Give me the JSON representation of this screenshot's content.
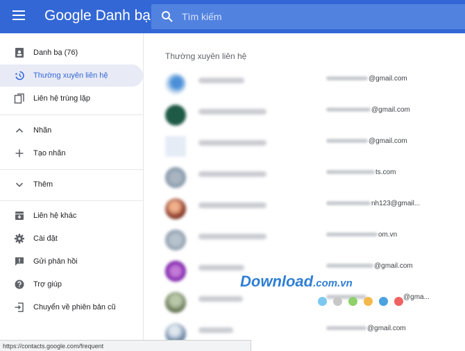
{
  "header": {
    "brand_google": "Google",
    "brand_product": "Danh bạ",
    "search_placeholder": "Tìm kiếm"
  },
  "sidebar": {
    "items": [
      {
        "label": "Danh bạ (76)",
        "icon": "contacts-icon",
        "active": false
      },
      {
        "label": "Thường xuyên liên hệ",
        "icon": "history-icon",
        "active": true
      },
      {
        "label": "Liên hệ trùng lặp",
        "icon": "duplicate-icon",
        "active": false
      },
      {
        "label": "Nhãn",
        "icon": "chevron-up-icon",
        "active": false
      },
      {
        "label": "Tạo nhãn",
        "icon": "plus-icon",
        "active": false
      },
      {
        "label": "Thêm",
        "icon": "chevron-down-icon",
        "active": false
      },
      {
        "label": "Liên hệ khác",
        "icon": "archive-icon",
        "active": false
      },
      {
        "label": "Cài đặt",
        "icon": "gear-icon",
        "active": false
      },
      {
        "label": "Gửi phản hồi",
        "icon": "feedback-icon",
        "active": false
      },
      {
        "label": "Trợ giúp",
        "icon": "help-icon",
        "active": false
      },
      {
        "label": "Chuyển về phiên bản cũ",
        "icon": "exit-icon",
        "active": false
      }
    ]
  },
  "main": {
    "section_title": "Thường xuyên liên hệ",
    "contacts": [
      {
        "email_suffix": "@gmail.com"
      },
      {
        "email_suffix": "@gmail.com"
      },
      {
        "email_suffix": "@gmail.com"
      },
      {
        "email_suffix": "ts.com"
      },
      {
        "email_suffix": "nh123@gmail..."
      },
      {
        "email_suffix": "om.vn"
      },
      {
        "email_suffix": "@gmail.com"
      },
      {
        "email_suffix": "@gma..."
      },
      {
        "email_suffix": "@gmail.com"
      }
    ]
  },
  "watermark": {
    "text": "Download",
    "tld": ".com.vn"
  },
  "statusbar": {
    "url": "https://contacts.google.com/frequent"
  },
  "colors": {
    "header": "#3367d6",
    "active": "#3367d6",
    "active_bg": "#e8eaf6"
  }
}
